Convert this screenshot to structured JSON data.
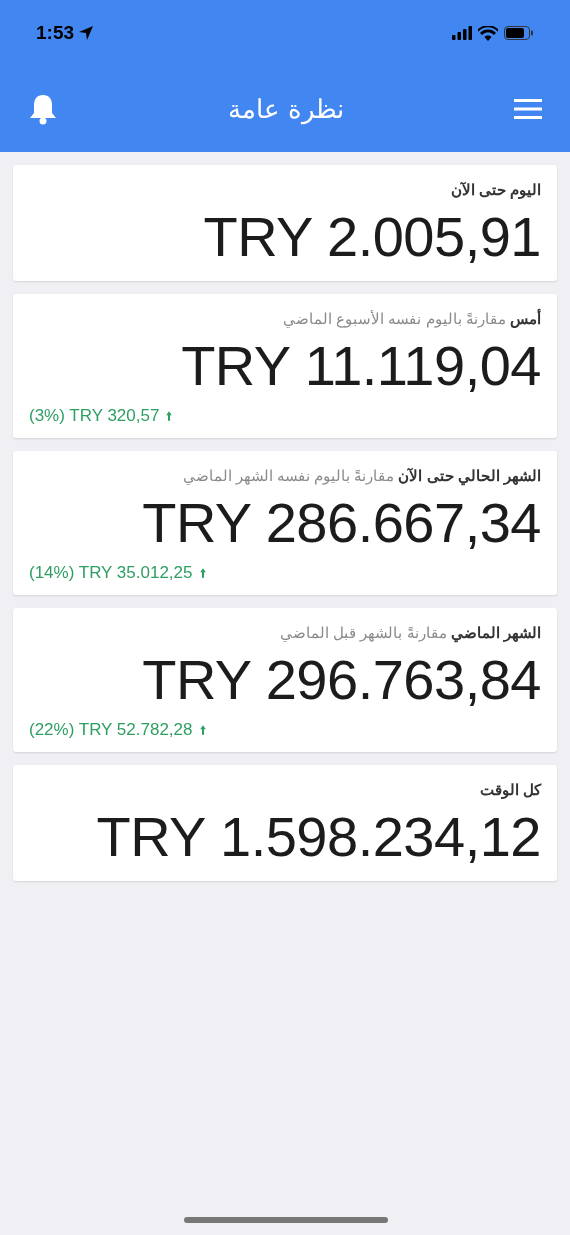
{
  "status_bar": {
    "time": "1:53"
  },
  "header": {
    "title": "نظرة عامة"
  },
  "cards": [
    {
      "title": "اليوم حتى الآن",
      "value": "TRY 2.005,91"
    },
    {
      "title": "أمس",
      "comparison": "مقارنةً باليوم نفسه الأسبوع الماضي",
      "value": "TRY 11.119,04",
      "change": "(3%) TRY 320,57",
      "rising": true
    },
    {
      "title": "الشهر الحالي حتى الآن",
      "comparison": "مقارنةً باليوم نفسه الشهر الماضي",
      "value": "TRY 286.667,34",
      "change": "(14%) TRY 35.012,25",
      "rising": true
    },
    {
      "title": "الشهر الماضي",
      "comparison": "مقارنةً بالشهر قبل الماضي",
      "value": "TRY 296.763,84",
      "change": "(22%) TRY 52.782,28",
      "rising": true
    },
    {
      "title": "كل الوقت",
      "value": "TRY 1.598.234,12"
    }
  ]
}
